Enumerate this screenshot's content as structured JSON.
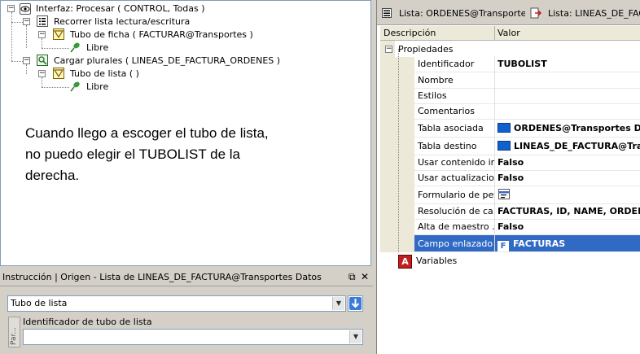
{
  "tree": {
    "root_label": "Interfaz: Procesar ( CONTROL, Todas )",
    "loop_label": "Recorrer lista lectura/escritura",
    "file_tube_label": "Tubo de ficha ( FACTURAR@Transportes )",
    "free1_label": "Libre",
    "load_plurals_label": "Cargar plurales ( LINEAS_DE_FACTURA_ORDENES )",
    "list_tube_label": "Tubo de lista (  )",
    "free2_label": "Libre",
    "expander_minus": "⊟"
  },
  "note": {
    "line1": "Cuando llego a escoger el tubo de lista,",
    "line2": "no puedo elegir el TUBOLIST de la",
    "line3": "derecha."
  },
  "instruction": {
    "title": "Instrucción | Origen - Lista de LINEAS_DE_FACTURA@Transportes Datos",
    "pin_glyph": "⧉",
    "close_glyph": "✕",
    "select_value": "Tubo de lista",
    "field_label": "Identificador de tubo de lista",
    "side_tab": "Par...",
    "field_value": ""
  },
  "tabs": {
    "tab1": "Lista: ORDENES@Transportes Da",
    "tab2": "Lista: LINEAS_DE_FACTU"
  },
  "grid": {
    "col_desc": "Descripción",
    "col_val": "Valor",
    "group_label": "Propiedades",
    "variables_label": "Variables",
    "rows": [
      {
        "name": "Identificador",
        "value": "TUBOLIST"
      },
      {
        "name": "Nombre",
        "value": ""
      },
      {
        "name": "Estilos",
        "value": ""
      },
      {
        "name": "Comentarios",
        "value": ""
      },
      {
        "name": "Tabla asociada",
        "value": "ORDENES@Transportes Datos"
      },
      {
        "name": "Tabla destino",
        "value": "LINEAS_DE_FACTURA@Tran"
      },
      {
        "name": "Usar contenido in...",
        "value": "Falso"
      },
      {
        "name": "Usar actualizacio...",
        "value": "Falso"
      },
      {
        "name": "Formulario de pet...",
        "value": ""
      },
      {
        "name": "Resolución de ca...",
        "value": "FACTURAS, ID, NAME, ORDENES"
      },
      {
        "name": "Alta de maestro ...",
        "value": "Falso"
      },
      {
        "name": "Campo enlazado ...",
        "value": "FACTURAS"
      }
    ]
  },
  "colors": {
    "selection": "#316ac5",
    "folder": "#1060d0"
  }
}
